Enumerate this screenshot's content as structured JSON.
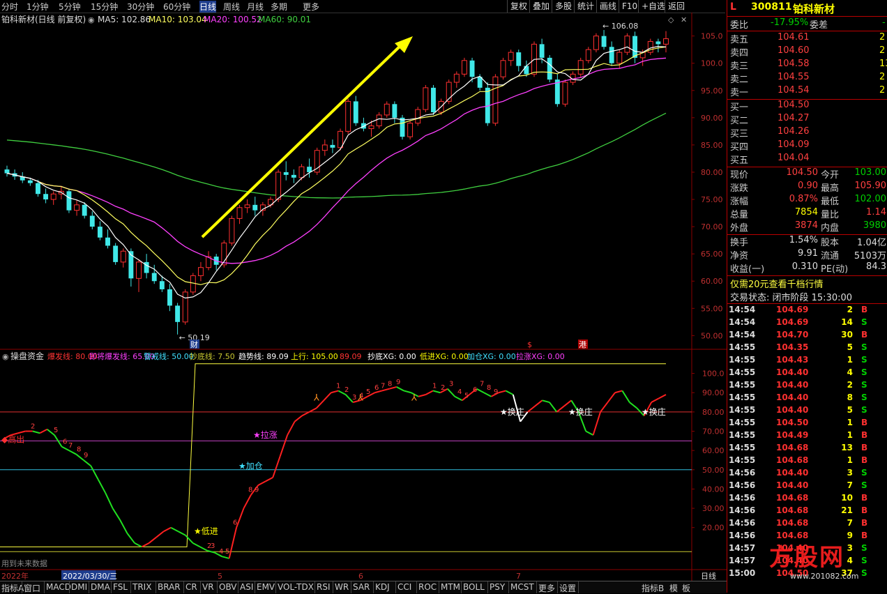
{
  "toolbar": {
    "periods": [
      "分时",
      "1分钟",
      "5分钟",
      "15分钟",
      "30分钟",
      "60分钟",
      "日线",
      "周线",
      "月线",
      "多期",
      "更多"
    ],
    "active": "日线",
    "right_buttons": [
      "复权",
      "叠加",
      "多股",
      "统计",
      "画线",
      "F10",
      "+自选",
      "返回"
    ],
    "mark_label": "标记"
  },
  "main_legend": {
    "title": "铂科新材(日线 前复权)",
    "ma5": "MA5: 102.86",
    "ma10": "MA10: 103.04",
    "ma20": "MA20: 100.52",
    "ma60": "MA60: 90.01"
  },
  "annotations": {
    "high_label": "106.08",
    "low_label": "50.19",
    "cai": "财",
    "dollar": "$",
    "gang": "港"
  },
  "price_axis": [
    "105.0",
    "100.0",
    "95.00",
    "90.00",
    "85.00",
    "80.00",
    "75.00",
    "70.00",
    "65.00",
    "60.00",
    "55.00",
    "50.00"
  ],
  "indicator": {
    "name": "操盘资金",
    "items": [
      {
        "label": "爆发线: 80.00",
        "color": "#ff3333"
      },
      {
        "label": "即将爆发线: 65.00",
        "color": "#ff40ff"
      },
      {
        "label": "警戒线: 50.00",
        "color": "#40e0ff"
      },
      {
        "label": "抄底线: 7.50",
        "color": "#c8c830"
      },
      {
        "label": "趋势线: 89.09",
        "color": "#ffffff"
      },
      {
        "label": "上行: 105.00",
        "color": "#ffff00"
      },
      {
        "label": "89.09",
        "color": "#ff3333"
      },
      {
        "label": "抄底XG: 0.00",
        "color": "#ffffff"
      },
      {
        "label": "低进XG: 0.00",
        "color": "#ffff00"
      },
      {
        "label": "加仓XG: 0.00",
        "color": "#40e0ff"
      },
      {
        "label": "拉涨XG: 0.00",
        "color": "#ff40ff"
      }
    ],
    "axis": [
      "100.0",
      "90.00",
      "80.00",
      "70.00",
      "60.00",
      "50.00",
      "40.00",
      "30.00",
      "20.00"
    ],
    "signals": {
      "gaochu": "高出",
      "dijin": "低进",
      "jiacang": "加仓",
      "lazhang": "拉涨",
      "huanzhuang": "换庄"
    },
    "future_note": "用到未来数据"
  },
  "date_axis": {
    "year": "2022年",
    "cursor_date": "2022/03/30/三",
    "months": [
      "5",
      "6",
      "7"
    ],
    "period_label": "日线"
  },
  "bottom_tabs": [
    "指标A",
    "窗口",
    "MACD",
    "DMI",
    "DMA",
    "FSL",
    "TRIX",
    "BRAR",
    "CR",
    "VR",
    "OBV",
    "ASI",
    "EMV",
    "VOL-TDX",
    "RSI",
    "WR",
    "SAR",
    "KDJ",
    "CCI",
    "ROC",
    "MTM",
    "BOLL",
    "PSY",
    "MCST",
    "更多",
    "设置"
  ],
  "bottom_right": [
    "指标B",
    "模",
    "板"
  ],
  "quote": {
    "flag": "L",
    "code": "300811",
    "name": "铂科新材",
    "weibi_label": "委比",
    "weibi": "-17.95%",
    "weicha_label": "委差",
    "weicha": "-",
    "sells": [
      {
        "label": "卖五",
        "price": "104.61",
        "vol": "2"
      },
      {
        "label": "卖四",
        "price": "104.60",
        "vol": "2"
      },
      {
        "label": "卖三",
        "price": "104.58",
        "vol": "13"
      },
      {
        "label": "卖二",
        "price": "104.55",
        "vol": "2"
      },
      {
        "label": "卖一",
        "price": "104.54",
        "vol": "2"
      }
    ],
    "buys": [
      {
        "label": "买一",
        "price": "104.50",
        "vol": ""
      },
      {
        "label": "买二",
        "price": "104.27",
        "vol": ""
      },
      {
        "label": "买三",
        "price": "104.26",
        "vol": ""
      },
      {
        "label": "买四",
        "price": "104.09",
        "vol": ""
      },
      {
        "label": "买五",
        "price": "104.04",
        "vol": ""
      }
    ],
    "stats": [
      {
        "l1": "现价",
        "v1": "104.50",
        "l2": "今开",
        "v2": "103.00"
      },
      {
        "l1": "涨跌",
        "v1": "0.90",
        "l2": "最高",
        "v2": "105.90"
      },
      {
        "l1": "涨幅",
        "v1": "0.87%",
        "l2": "最低",
        "v2": "102.00"
      },
      {
        "l1": "总量",
        "v1": "7854",
        "l2": "量比",
        "v2": "1.14"
      },
      {
        "l1": "外盘",
        "v1": "3874",
        "l2": "内盘",
        "v2": "3980"
      }
    ],
    "stats2": [
      {
        "l1": "换手",
        "v1": "1.54%",
        "l2": "股本",
        "v2": "1.04亿"
      },
      {
        "l1": "净资",
        "v1": "9.91",
        "l2": "流通",
        "v2": "5103万"
      },
      {
        "l1": "收益(一)",
        "v1": "0.310",
        "l2": "PE(动)",
        "v2": "84.3"
      }
    ],
    "promo": "仅需20元查看千档行情",
    "trade_status": "交易状态: 闭市阶段 15:30:00",
    "ticks": [
      {
        "t": "14:54",
        "p": "104.69",
        "v": "2",
        "d": "B"
      },
      {
        "t": "14:54",
        "p": "104.69",
        "v": "14",
        "d": "S"
      },
      {
        "t": "14:54",
        "p": "104.70",
        "v": "30",
        "d": "B"
      },
      {
        "t": "14:55",
        "p": "104.35",
        "v": "5",
        "d": "S"
      },
      {
        "t": "14:55",
        "p": "104.43",
        "v": "1",
        "d": "S"
      },
      {
        "t": "14:55",
        "p": "104.40",
        "v": "4",
        "d": "S"
      },
      {
        "t": "14:55",
        "p": "104.40",
        "v": "2",
        "d": "S"
      },
      {
        "t": "14:55",
        "p": "104.40",
        "v": "8",
        "d": "S"
      },
      {
        "t": "14:55",
        "p": "104.40",
        "v": "5",
        "d": "S"
      },
      {
        "t": "14:55",
        "p": "104.50",
        "v": "1",
        "d": "B"
      },
      {
        "t": "14:55",
        "p": "104.49",
        "v": "1",
        "d": "B"
      },
      {
        "t": "14:55",
        "p": "104.68",
        "v": "13",
        "d": "B"
      },
      {
        "t": "14:55",
        "p": "104.68",
        "v": "1",
        "d": "B"
      },
      {
        "t": "14:56",
        "p": "104.40",
        "v": "3",
        "d": "S"
      },
      {
        "t": "14:56",
        "p": "104.40",
        "v": "7",
        "d": "S"
      },
      {
        "t": "14:56",
        "p": "104.68",
        "v": "10",
        "d": "B"
      },
      {
        "t": "14:56",
        "p": "104.68",
        "v": "21",
        "d": "B"
      },
      {
        "t": "14:56",
        "p": "104.68",
        "v": "7",
        "d": "B"
      },
      {
        "t": "14:56",
        "p": "104.68",
        "v": "9",
        "d": "B"
      },
      {
        "t": "14:57",
        "p": "104.40",
        "v": "3",
        "d": "S"
      },
      {
        "t": "14:57",
        "p": "104.40",
        "v": "4",
        "d": "S"
      },
      {
        "t": "15:00",
        "p": "104.50",
        "v": "37",
        "d": "S"
      }
    ],
    "watermark": "方股网",
    "watermark_url": "www.201082.com"
  },
  "colors": {
    "up": "#ff3030",
    "down": "#40e8e8",
    "ma5": "#ffffff",
    "ma10": "#ffff60",
    "ma20": "#ff40ff",
    "ma60": "#40d040",
    "grid": "#8b0000"
  },
  "chart_data": {
    "type": "candlestick",
    "ylim": [
      48,
      107
    ],
    "candles": [
      [
        80.5,
        81.2,
        79.2,
        79.8
      ],
      [
        79.8,
        80.5,
        78.6,
        79.2
      ],
      [
        79.2,
        80.0,
        78.0,
        78.5
      ],
      [
        78.5,
        79.0,
        77.5,
        78.0
      ],
      [
        78.0,
        78.6,
        75.5,
        76.0
      ],
      [
        76.0,
        77.0,
        74.3,
        75.0
      ],
      [
        75.0,
        76.5,
        74.0,
        76.0
      ],
      [
        76.0,
        77.5,
        75.0,
        76.5
      ],
      [
        76.5,
        77.0,
        72.5,
        73.0
      ],
      [
        73.0,
        74.8,
        72.0,
        74.0
      ],
      [
        74.0,
        74.5,
        71.5,
        72.0
      ],
      [
        72.0,
        72.8,
        69.5,
        70.0
      ],
      [
        70.0,
        71.0,
        67.5,
        68.0
      ],
      [
        68.0,
        69.5,
        66.0,
        66.5
      ],
      [
        66.5,
        67.0,
        63.0,
        63.5
      ],
      [
        63.5,
        66.0,
        62.5,
        65.5
      ],
      [
        65.5,
        66.0,
        59.0,
        60.5
      ],
      [
        60.5,
        64.0,
        58.0,
        63.5
      ],
      [
        63.5,
        65.0,
        60.5,
        61.5
      ],
      [
        61.5,
        63.0,
        59.5,
        60.0
      ],
      [
        60.0,
        61.0,
        58.0,
        58.5
      ],
      [
        58.5,
        59.5,
        54.5,
        55.5
      ],
      [
        55.5,
        56.0,
        50.2,
        52.5
      ],
      [
        52.5,
        58.5,
        52.0,
        58.0
      ],
      [
        58.0,
        61.5,
        57.5,
        61.0
      ],
      [
        61.0,
        63.5,
        60.0,
        62.5
      ],
      [
        62.5,
        65.5,
        62.0,
        64.5
      ],
      [
        64.5,
        65.0,
        62.0,
        63.0
      ],
      [
        63.0,
        67.5,
        62.5,
        67.0
      ],
      [
        67.0,
        72.0,
        66.5,
        71.5
      ],
      [
        71.5,
        74.0,
        70.5,
        73.5
      ],
      [
        73.5,
        75.0,
        72.5,
        74.0
      ],
      [
        74.0,
        75.5,
        72.0,
        73.0
      ],
      [
        73.0,
        74.5,
        72.0,
        74.0
      ],
      [
        74.0,
        75.5,
        73.5,
        75.0
      ],
      [
        75.0,
        80.5,
        74.5,
        80.0
      ],
      [
        80.0,
        82.0,
        78.5,
        79.5
      ],
      [
        79.5,
        80.5,
        78.0,
        79.0
      ],
      [
        79.0,
        81.5,
        78.5,
        81.0
      ],
      [
        81.0,
        82.5,
        79.0,
        80.0
      ],
      [
        80.0,
        84.5,
        79.5,
        84.0
      ],
      [
        84.0,
        86.0,
        83.0,
        85.0
      ],
      [
        85.0,
        86.0,
        83.5,
        84.5
      ],
      [
        84.5,
        88.0,
        84.0,
        87.5
      ],
      [
        87.5,
        93.5,
        87.0,
        93.0
      ],
      [
        93.0,
        94.0,
        88.5,
        89.0
      ],
      [
        89.0,
        90.0,
        87.5,
        88.0
      ],
      [
        88.0,
        89.5,
        86.5,
        88.5
      ],
      [
        88.5,
        91.0,
        88.0,
        90.5
      ],
      [
        90.5,
        93.0,
        90.0,
        92.5
      ],
      [
        92.5,
        93.0,
        89.0,
        90.0
      ],
      [
        90.0,
        90.5,
        86.0,
        86.5
      ],
      [
        86.5,
        89.5,
        86.0,
        89.0
      ],
      [
        89.0,
        92.0,
        88.5,
        91.5
      ],
      [
        91.5,
        96.0,
        91.0,
        95.5
      ],
      [
        95.5,
        96.0,
        90.5,
        91.0
      ],
      [
        91.0,
        93.5,
        90.5,
        93.0
      ],
      [
        93.0,
        97.0,
        92.5,
        96.5
      ],
      [
        96.5,
        98.5,
        95.5,
        98.0
      ],
      [
        98.0,
        101.0,
        97.5,
        100.5
      ],
      [
        100.5,
        101.0,
        96.5,
        97.5
      ],
      [
        97.5,
        98.0,
        95.0,
        95.5
      ],
      [
        95.5,
        96.5,
        88.5,
        89.0
      ],
      [
        89.0,
        98.0,
        88.5,
        97.5
      ],
      [
        97.5,
        101.0,
        97.0,
        100.5
      ],
      [
        100.5,
        102.5,
        99.5,
        102.0
      ],
      [
        102.0,
        102.5,
        98.5,
        99.5
      ],
      [
        99.5,
        100.5,
        97.5,
        98.0
      ],
      [
        98.0,
        104.0,
        97.5,
        103.5
      ],
      [
        103.5,
        104.5,
        100.0,
        101.0
      ],
      [
        101.0,
        101.5,
        96.5,
        97.0
      ],
      [
        97.0,
        98.0,
        92.0,
        92.5
      ],
      [
        92.5,
        97.0,
        92.0,
        96.5
      ],
      [
        96.5,
        98.5,
        96.0,
        98.0
      ],
      [
        98.0,
        101.0,
        97.5,
        100.5
      ],
      [
        100.5,
        103.0,
        100.0,
        102.5
      ],
      [
        102.5,
        105.5,
        102.0,
        105.0
      ],
      [
        105.0,
        106.1,
        102.5,
        103.0
      ],
      [
        103.0,
        104.0,
        99.5,
        100.0
      ],
      [
        100.0,
        102.5,
        99.0,
        102.0
      ],
      [
        102.0,
        105.5,
        101.5,
        105.0
      ],
      [
        105.0,
        105.8,
        100.0,
        101.0
      ],
      [
        101.0,
        102.5,
        99.5,
        102.0
      ],
      [
        102.0,
        104.5,
        101.5,
        104.0
      ],
      [
        104.0,
        104.5,
        102.0,
        103.5
      ],
      [
        103.5,
        105.9,
        102.0,
        104.5
      ]
    ],
    "ma60_start": 86.0,
    "indicator_line": [
      66,
      68,
      69,
      70,
      70,
      69,
      71,
      68,
      62,
      60,
      58,
      55,
      52,
      45,
      38,
      30,
      24,
      17,
      12,
      10,
      12,
      15,
      18,
      20,
      18,
      16,
      12,
      10,
      8,
      7,
      5,
      4,
      20,
      30,
      37,
      42,
      44,
      46,
      57,
      68,
      75,
      78,
      80,
      82,
      86,
      90,
      91,
      89,
      85,
      86,
      88,
      90,
      91,
      92,
      93,
      91,
      90,
      88,
      89,
      91,
      90,
      92,
      88,
      86,
      89,
      92,
      90,
      88,
      90,
      91,
      89,
      75,
      80,
      83,
      86,
      85,
      80,
      83,
      86,
      80,
      70,
      68,
      80,
      85,
      90,
      91,
      85,
      82,
      78,
      85,
      87,
      89
    ]
  }
}
